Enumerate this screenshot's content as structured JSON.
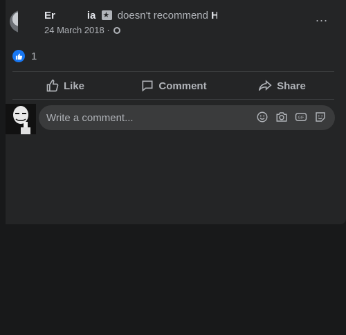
{
  "post": {
    "author_visible_start": "Er",
    "author_visible_end": "ia",
    "verb": "doesn't recommend",
    "target_partial": "H",
    "date": "24 March 2018",
    "date_separator": "·"
  },
  "reactions": {
    "count": "1",
    "icon": "like-reaction-icon",
    "color": "#1877f2"
  },
  "actions": {
    "like": "Like",
    "comment": "Comment",
    "share": "Share"
  },
  "composer": {
    "placeholder": "Write a comment...",
    "icons": [
      "emoji-icon",
      "camera-icon",
      "gif-icon",
      "sticker-icon"
    ]
  },
  "more_icon": "..."
}
